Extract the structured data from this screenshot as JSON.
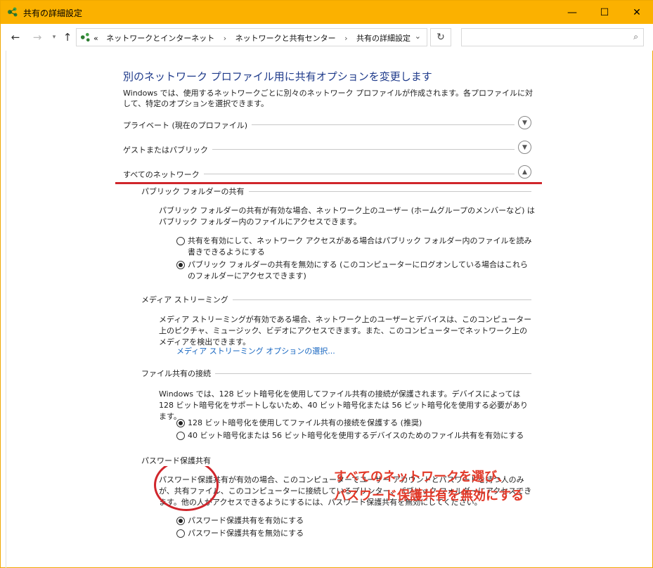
{
  "window": {
    "title": "共有の詳細設定",
    "minimize": "—",
    "maximize": "☐",
    "close": "✕"
  },
  "address": {
    "prefix": "«",
    "crumbs": [
      "ネットワークとインターネット",
      "ネットワークと共有センター",
      "共有の詳細設定"
    ],
    "separator": "›"
  },
  "search": {
    "placeholder": ""
  },
  "main": {
    "heading": "別のネットワーク プロファイル用に共有オプションを変更します",
    "description": "Windows では、使用するネットワークごとに別々のネットワーク プロファイルが作成されます。各プロファイルに対して、特定のオプションを選択できます。",
    "profiles": [
      {
        "label": "プライベート (現在のプロファイル)",
        "expanded": false
      },
      {
        "label": "ゲストまたはパブリック",
        "expanded": false
      },
      {
        "label": "すべてのネットワーク",
        "expanded": true
      }
    ]
  },
  "public_folder": {
    "title": "パブリック フォルダーの共有",
    "text": "パブリック フォルダーの共有が有効な場合、ネットワーク上のユーザー (ホームグループのメンバーなど) はパブリック フォルダー内のファイルにアクセスできます。",
    "options": [
      {
        "label": "共有を有効にして、ネットワーク アクセスがある場合はパブリック フォルダー内のファイルを読み書きできるようにする",
        "selected": false
      },
      {
        "label": "パブリック フォルダーの共有を無効にする (このコンピューターにログオンしている場合はこれらのフォルダーにアクセスできます)",
        "selected": true
      }
    ]
  },
  "media": {
    "title": "メディア ストリーミング",
    "text": "メディア ストリーミングが有効である場合、ネットワーク上のユーザーとデバイスは、このコンピューター上のピクチャ、ミュージック、ビデオにアクセスできます。また、このコンピューターでネットワーク上のメディアを検出できます。",
    "link": "メディア ストリーミング オプションの選択..."
  },
  "file_sharing": {
    "title": "ファイル共有の接続",
    "text": "Windows では、128 ビット暗号化を使用してファイル共有の接続が保護されます。デバイスによっては 128 ビット暗号化をサポートしないため、40 ビット暗号化または 56 ビット暗号化を使用する必要があります。",
    "options": [
      {
        "label": "128 ビット暗号化を使用してファイル共有の接続を保護する (推奨)",
        "selected": true
      },
      {
        "label": "40 ビット暗号化または 56 ビット暗号化を使用するデバイスのためのファイル共有を有効にする",
        "selected": false
      }
    ]
  },
  "password": {
    "title": "パスワード保護共有",
    "text": "パスワード保護共有が有効の場合、このコンピューターでユーザー アカウントとパスワードを持つ人のみが、共有ファイル、このコンピューターに接続しているプリンター、パブリック フォルダーにアクセスできます。他の人がアクセスできるようにするには、パスワード保護共有を無効にしてください。",
    "options": [
      {
        "label": "パスワード保護共有を有効にする",
        "selected": true
      },
      {
        "label": "パスワード保護共有を無効にする",
        "selected": false
      }
    ]
  },
  "annotation": {
    "line1": "すべてのネットワークを選び、",
    "line2": "パスワード保護共有を無効にする",
    "color": "#e23a2a"
  }
}
